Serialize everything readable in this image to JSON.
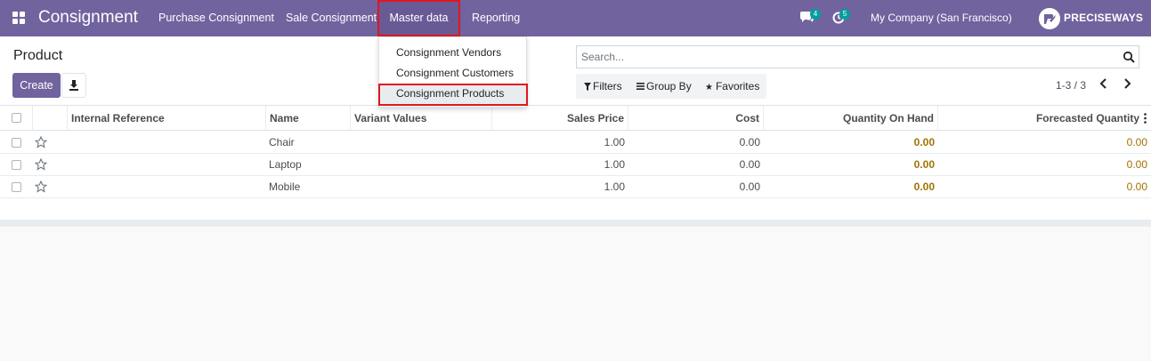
{
  "navbar": {
    "app_title": "Consignment",
    "menus": [
      "Purchase Consignment",
      "Sale Consignment",
      "Master data",
      "Reporting"
    ],
    "chat_count": "4",
    "activity_count": "5",
    "company": "My Company (San Francisco)",
    "user": "PRECISEWAYS",
    "color": "#71639e"
  },
  "dropdown": {
    "items": [
      "Consignment Vendors",
      "Consignment Customers",
      "Consignment Products"
    ],
    "active_index": 2
  },
  "control_panel": {
    "breadcrumb": "Product",
    "create_label": "Create",
    "search_placeholder": "Search...",
    "filters_label": "Filters",
    "groupby_label": "Group By",
    "favorites_label": "Favorites",
    "pager": "1-3 / 3"
  },
  "table": {
    "columns": [
      "Internal Reference",
      "Name",
      "Variant Values",
      "Sales Price",
      "Cost",
      "Quantity On Hand",
      "Forecasted Quantity"
    ],
    "rows": [
      {
        "internal_reference": "",
        "name": "Chair",
        "variant_values": "",
        "sales_price": "1.00",
        "cost": "0.00",
        "qty_on_hand": "0.00",
        "forecasted": "0.00"
      },
      {
        "internal_reference": "",
        "name": "Laptop",
        "variant_values": "",
        "sales_price": "1.00",
        "cost": "0.00",
        "qty_on_hand": "0.00",
        "forecasted": "0.00"
      },
      {
        "internal_reference": "",
        "name": "Mobile",
        "variant_values": "",
        "sales_price": "1.00",
        "cost": "0.00",
        "qty_on_hand": "0.00",
        "forecasted": "0.00"
      }
    ],
    "warning_color": "#a07300"
  },
  "highlight_color": "#e0161e"
}
